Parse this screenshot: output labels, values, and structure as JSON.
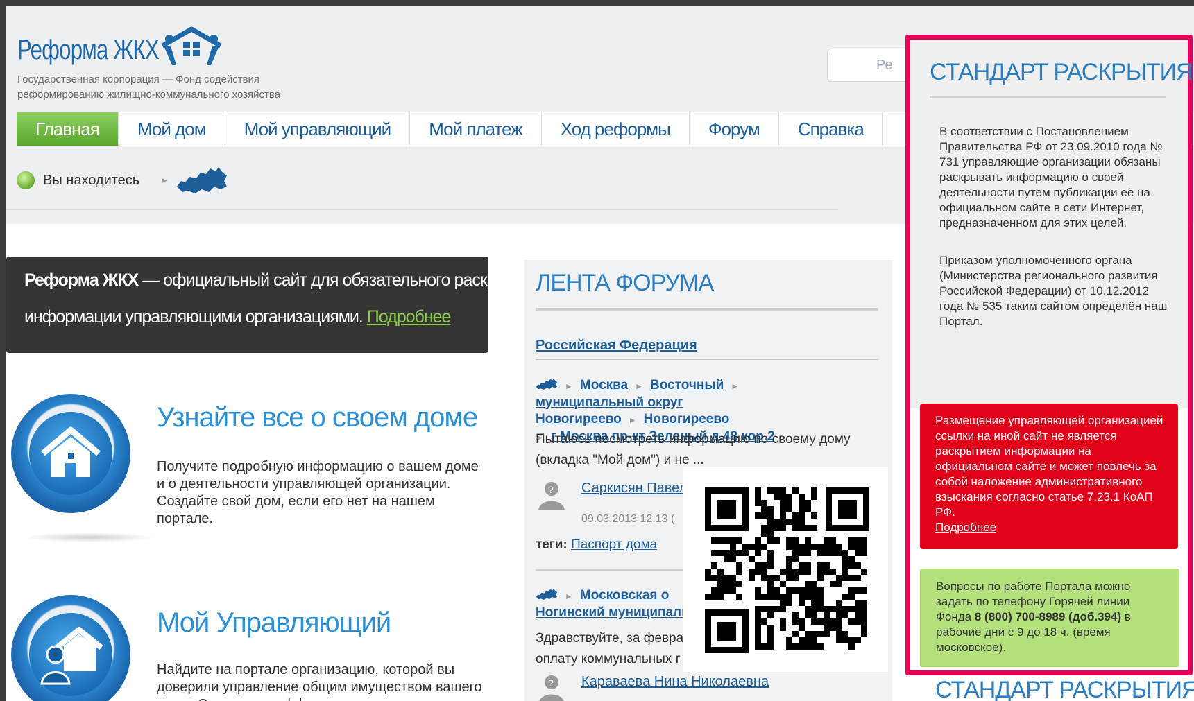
{
  "logo": {
    "title": "Реформа ЖКХ",
    "subtitle_line1": "Государственная корпорация — Фонд содействия",
    "subtitle_line2": "реформированию жилищно-коммунального хозяйства"
  },
  "search": {
    "visible_text": "Ре"
  },
  "nav": {
    "items": [
      {
        "label": "Главная",
        "active": true
      },
      {
        "label": "Мой дом"
      },
      {
        "label": "Мой управляющий"
      },
      {
        "label": "Мой платеж"
      },
      {
        "label": "Ход реформы"
      },
      {
        "label": "Форум"
      },
      {
        "label": "Справка"
      }
    ]
  },
  "location": {
    "label": "Вы находитесь"
  },
  "banner": {
    "bold": "Реформа ЖКХ",
    "line1_rest": " — официальный сайт для обязательного раскрытия",
    "line2": "информации управляющими организациями.",
    "link": "Подробнее"
  },
  "features": [
    {
      "title": "Узнайте все о своем доме",
      "body": "Получите подробную информацию о вашем доме и о деятельности управляющей организации. Создайте свой дом, если его нет на нашем портале."
    },
    {
      "title": "Мой Управляющий",
      "body": "Найдите на портале организацию, которой вы доверили управление общим имуществом вашего дома. Оцените ее эффективность."
    }
  ],
  "forum": {
    "title": "ЛЕНТА ФОРУМА",
    "region": "Российская Федерация",
    "post1": {
      "path": [
        "Москва",
        "Восточный",
        "муниципальный округ Новогиреево",
        "Новогиреево",
        "г Москва пр-кт Зеленый д.48 кор.2"
      ],
      "text": "Пытаюсь посмотреть информацию по своему дому (вкладка \"Мой дом\") и не ...",
      "author": "Саркисян Павел",
      "date": "09.03.2013 12:13 (",
      "tags_label": "теги:",
      "tag": "Паспорт дома"
    },
    "post2": {
      "path": [
        "Московская о",
        "Ногинский муниципаль"
      ],
      "text_l1": "Здравствуйте, за февра",
      "text_l2": "оплату коммунальных г",
      "author": "Караваева Нина Николаевна"
    }
  },
  "sidebar": {
    "title": "СТАНДАРТ РАСКРЫТИЯ",
    "p1": "В соответствии с Постановлением Правительства РФ от 23.09.2010 года № 731 управляющие организации обязаны раскрывать информацию о своей деятельности путем публикации её на официальном сайте в сети Интернет, предназначенном для этих целей.",
    "p2": "Приказом уполномоченного органа (Министерства регионального развития Российской Федерации) от 10.12.2012 года № 535 таким сайтом определён наш Портал.",
    "red_text": "Размещение управляющей организацией ссылки на иной сайт не является раскрытием информации на официальном сайте и может повлечь за собой наложение административного взыскания согласно статье 7.23.1 КоАП РФ.",
    "red_link": "Подробнее",
    "green_before": "Вопросы по работе Портала можно задать по телефону Горячей линии Фонда ",
    "green_phone": "8 (800) 700-8989 (доб.394)",
    "green_after": " в рабочие дни с 9 до 18 ч. (время московское)."
  },
  "bottom_title": "СТАНДАРТ РАСКРЫТИЯ",
  "colors": {
    "accent": "#1d5e98",
    "highlight_border": "#e5005a",
    "warning": "#e1001a",
    "info": "#b5e07e",
    "nav_active": "#6cb63c"
  }
}
